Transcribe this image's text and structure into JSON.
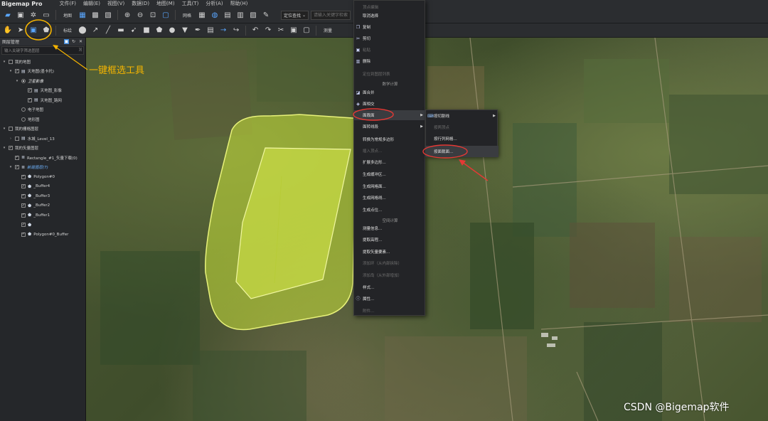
{
  "app": {
    "title": "Bigemap Pro",
    "menus": [
      "文件(F)",
      "编辑(E)",
      "视图(V)",
      "数据(D)",
      "地图(M)",
      "工具(T)",
      "分析(A)",
      "帮助(H)"
    ]
  },
  "toolbar1": {
    "map_label": "地图",
    "grid_label": "网格",
    "locate_select": "定位查找",
    "search_placeholder": "请输入关键字检索"
  },
  "toolbar2": {
    "mark_label": "标绘",
    "measure_label": "测量"
  },
  "panel": {
    "title": "图层管理",
    "search_placeholder": "输入关键字筛选图层",
    "tree": [
      {
        "label": "我的地图",
        "level": 0,
        "exp": "▾",
        "check": "",
        "kind": "check",
        "icon": "",
        "style": ""
      },
      {
        "label": "天地图(墨卡托)",
        "level": 1,
        "exp": "▾",
        "check": "✓",
        "kind": "check",
        "icon": "▤",
        "style": ""
      },
      {
        "label": "卫星影像",
        "level": 2,
        "exp": "▾",
        "check": "on",
        "kind": "radio",
        "icon": "",
        "style": "italic"
      },
      {
        "label": "天地图_影像",
        "level": 3,
        "exp": "",
        "check": "✓",
        "kind": "check",
        "icon": "▤",
        "style": ""
      },
      {
        "label": "天地图_路网",
        "level": 3,
        "exp": "",
        "check": "✓",
        "kind": "check",
        "icon": "▤",
        "style": ""
      },
      {
        "label": "电子地图",
        "level": 2,
        "exp": "",
        "check": "off",
        "kind": "radio",
        "icon": "",
        "style": ""
      },
      {
        "label": "地形图",
        "level": 2,
        "exp": "",
        "check": "off",
        "kind": "radio",
        "icon": "",
        "style": ""
      },
      {
        "label": "我的栅格图层",
        "level": 0,
        "exp": "▾",
        "check": "",
        "kind": "check",
        "icon": "",
        "style": ""
      },
      {
        "label": "水城_Level_13",
        "level": 1,
        "exp": "›",
        "check": "",
        "kind": "check",
        "icon": "▤",
        "style": ""
      },
      {
        "label": "我的矢量图层",
        "level": 0,
        "exp": "▾",
        "check": "✓",
        "kind": "check",
        "icon": "",
        "style": ""
      },
      {
        "label": "Rectangle_#1_矢量下载(0)",
        "level": 1,
        "exp": "",
        "check": "✓",
        "kind": "check",
        "icon": "≣",
        "style": ""
      },
      {
        "label": "新建图层(7)",
        "level": 1,
        "exp": "▾",
        "check": "✓",
        "kind": "check",
        "icon": "≣",
        "style": "active"
      },
      {
        "label": "Polygon#0",
        "level": 2,
        "exp": "",
        "check": "✓",
        "kind": "check",
        "icon": "⬟",
        "style": ""
      },
      {
        "label": "_Buffer4",
        "level": 2,
        "exp": "",
        "check": "✓",
        "kind": "check",
        "icon": "⬟",
        "style": ""
      },
      {
        "label": "_Buffer3",
        "level": 2,
        "exp": "",
        "check": "✓",
        "kind": "check",
        "icon": "⬟",
        "style": ""
      },
      {
        "label": "_Buffer2",
        "level": 2,
        "exp": "",
        "check": "✓",
        "kind": "check",
        "icon": "⬟",
        "style": ""
      },
      {
        "label": "_Buffer1",
        "level": 2,
        "exp": "",
        "check": "✓",
        "kind": "check",
        "icon": "⬟",
        "style": ""
      },
      {
        "label": "",
        "level": 2,
        "exp": "",
        "check": "✓",
        "kind": "check",
        "icon": "⬟",
        "style": ""
      },
      {
        "label": "Polygon#0_Buffer",
        "level": 2,
        "exp": "",
        "check": "✓",
        "kind": "check",
        "icon": "⬟",
        "style": ""
      }
    ]
  },
  "context_menu": {
    "items": [
      {
        "label": "顶点编辑",
        "disabled": true,
        "section": false,
        "icon": "",
        "arrow": false,
        "highlight": false
      },
      {
        "label": "取消选择",
        "disabled": false,
        "section": false,
        "icon": "",
        "arrow": false,
        "highlight": false
      },
      {
        "label": "复制",
        "disabled": false,
        "section": false,
        "icon": "❐",
        "arrow": false,
        "highlight": false
      },
      {
        "label": "剪切",
        "disabled": false,
        "section": false,
        "icon": "✂",
        "arrow": false,
        "highlight": false
      },
      {
        "label": "粘贴",
        "disabled": true,
        "section": false,
        "icon": "▣",
        "arrow": false,
        "highlight": false
      },
      {
        "label": "删除",
        "disabled": false,
        "section": false,
        "icon": "▥",
        "arrow": false,
        "highlight": false
      },
      {
        "label": "定位到图层列表",
        "disabled": true,
        "section": false,
        "icon": "",
        "arrow": false,
        "highlight": false
      },
      {
        "label": "数学计算",
        "disabled": false,
        "section": true,
        "icon": "",
        "arrow": false,
        "highlight": false
      },
      {
        "label": "面合并",
        "disabled": false,
        "section": false,
        "icon": "◪",
        "arrow": false,
        "highlight": false
      },
      {
        "label": "面相交",
        "disabled": false,
        "section": false,
        "icon": "◈",
        "arrow": false,
        "highlight": false
      },
      {
        "label": "面裁面",
        "disabled": false,
        "section": false,
        "icon": "",
        "arrow": true,
        "highlight": true
      },
      {
        "label": "面转线段",
        "disabled": false,
        "section": false,
        "icon": "",
        "arrow": true,
        "highlight": false
      },
      {
        "label": "转换为常规多边形",
        "disabled": false,
        "section": false,
        "icon": "",
        "arrow": false,
        "highlight": false
      },
      {
        "label": "插入顶点...",
        "disabled": true,
        "section": false,
        "icon": "",
        "arrow": false,
        "highlight": false
      },
      {
        "label": "扩展多边形...",
        "disabled": false,
        "section": false,
        "icon": "",
        "arrow": false,
        "highlight": false
      },
      {
        "label": "生成缓冲区...",
        "disabled": false,
        "section": false,
        "icon": "",
        "arrow": false,
        "highlight": false
      },
      {
        "label": "生成网格面...",
        "disabled": false,
        "section": false,
        "icon": "",
        "arrow": false,
        "highlight": false
      },
      {
        "label": "生成网格线...",
        "disabled": false,
        "section": false,
        "icon": "",
        "arrow": false,
        "highlight": false
      },
      {
        "label": "生成点位...",
        "disabled": false,
        "section": false,
        "icon": "",
        "arrow": false,
        "highlight": false
      },
      {
        "label": "空间计算",
        "disabled": false,
        "section": true,
        "icon": "",
        "arrow": false,
        "highlight": false
      },
      {
        "label": "测量信息...",
        "disabled": false,
        "section": false,
        "icon": "",
        "arrow": false,
        "highlight": false
      },
      {
        "label": "提取高程...",
        "disabled": false,
        "section": false,
        "icon": "",
        "arrow": false,
        "highlight": false
      },
      {
        "label": "提取矢量要素...",
        "disabled": false,
        "section": false,
        "icon": "",
        "arrow": false,
        "highlight": false
      },
      {
        "label": "添加环（从内部拆除）",
        "disabled": true,
        "section": false,
        "icon": "",
        "arrow": false,
        "highlight": false
      },
      {
        "label": "添加岛（从外部增加）",
        "disabled": true,
        "section": false,
        "icon": "",
        "arrow": false,
        "highlight": false
      },
      {
        "label": "样式...",
        "disabled": false,
        "section": false,
        "icon": "",
        "arrow": false,
        "highlight": false
      },
      {
        "label": "属性...",
        "disabled": false,
        "section": false,
        "icon": "ⓘ",
        "arrow": false,
        "highlight": false
      },
      {
        "label": "附件...",
        "disabled": true,
        "section": false,
        "icon": "",
        "arrow": false,
        "highlight": false
      }
    ]
  },
  "submenu": {
    "items": [
      {
        "label": "按切割线",
        "disabled": false,
        "icon": "⌨",
        "arrow": true,
        "highlight": false
      },
      {
        "label": "按两顶点",
        "disabled": true,
        "icon": "",
        "arrow": false,
        "highlight": false
      },
      {
        "label": "按行列网格...",
        "disabled": false,
        "icon": "",
        "arrow": false,
        "highlight": false
      },
      {
        "label": "按面裁面...",
        "disabled": false,
        "icon": "",
        "arrow": false,
        "highlight": true
      }
    ]
  },
  "annotations": {
    "callout": "一键框选工具",
    "watermark": "CSDN @Bigemap软件",
    "callout_color": "#f5b400",
    "circle_color": "#e53935"
  },
  "colors": {
    "buffer_fill": "#c9e23a",
    "buffer_stroke": "#e8f27a",
    "polygon_fill": "#d4e84a"
  }
}
